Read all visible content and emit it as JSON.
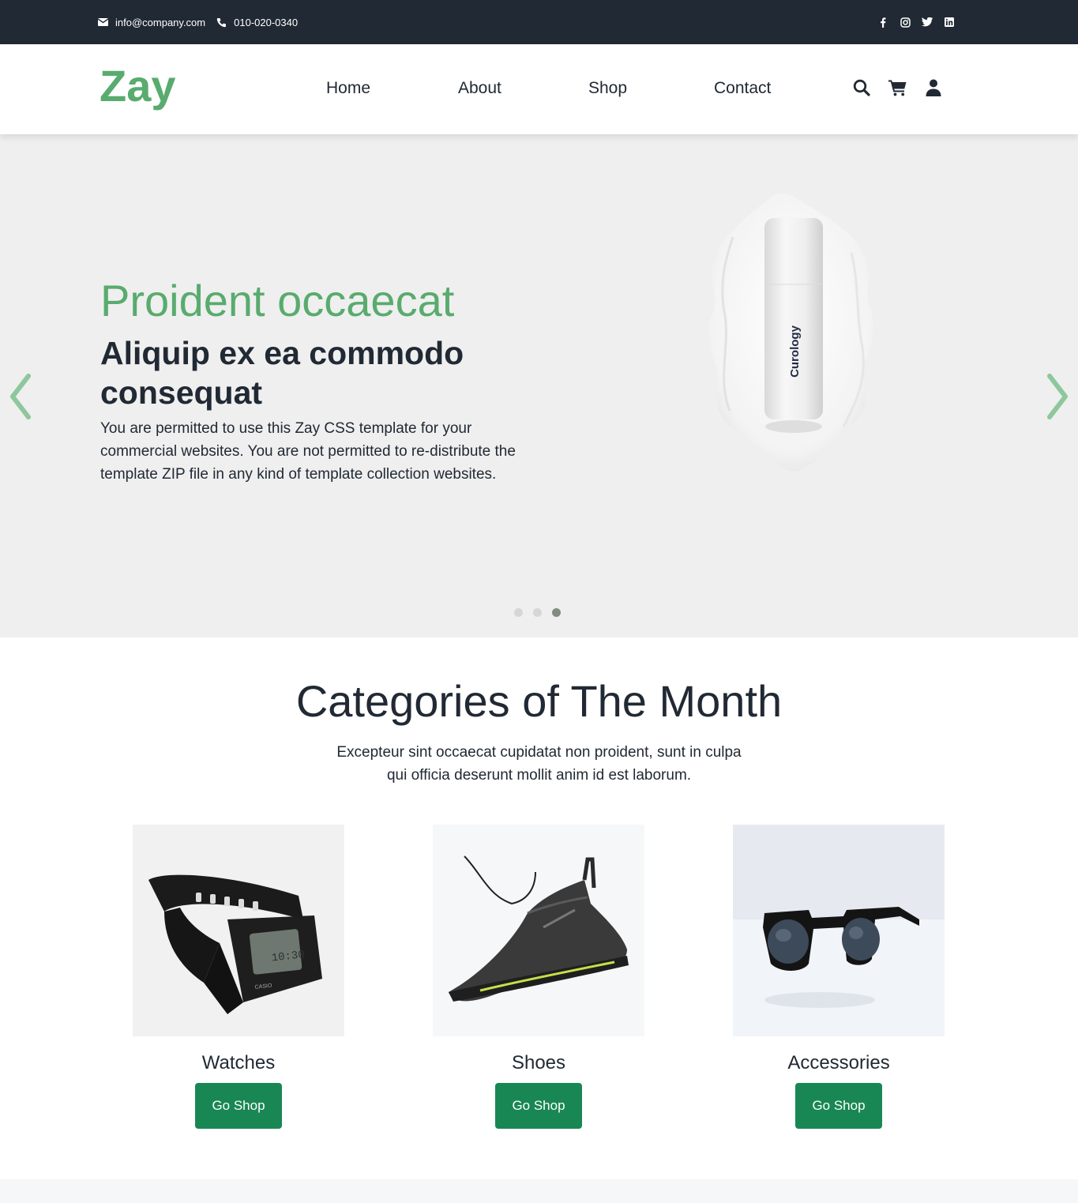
{
  "topbar": {
    "email": "info@company.com",
    "phone": "010-020-0340",
    "socials": [
      "facebook-icon",
      "instagram-icon",
      "twitter-icon",
      "linkedin-icon"
    ]
  },
  "header": {
    "logo": "Zay",
    "nav": [
      "Home",
      "About",
      "Shop",
      "Contact"
    ],
    "icons": [
      "search-icon",
      "cart-icon",
      "user-icon"
    ]
  },
  "hero": {
    "title": "Proident occaecat",
    "subtitle": "Aliquip ex ea commodo consequat",
    "description": "You are permitted to use this Zay CSS template for your commercial websites. You are not permitted to re-distribute the template ZIP file in any kind of template collection websites.",
    "product_label": "Curology",
    "slides": 3,
    "active_slide": 3
  },
  "categories": {
    "title": "Categories of The Month",
    "description": "Excepteur sint occaecat cupidatat non proident, sunt in culpa qui officia deserunt mollit anim id est laborum.",
    "items": [
      {
        "name": "Watches",
        "button": "Go Shop"
      },
      {
        "name": "Shoes",
        "button": "Go Shop"
      },
      {
        "name": "Accessories",
        "button": "Go Shop"
      }
    ]
  },
  "colors": {
    "brand": "#59ab6e",
    "dark": "#212934",
    "button": "#198754",
    "hero_bg": "#efefef"
  }
}
